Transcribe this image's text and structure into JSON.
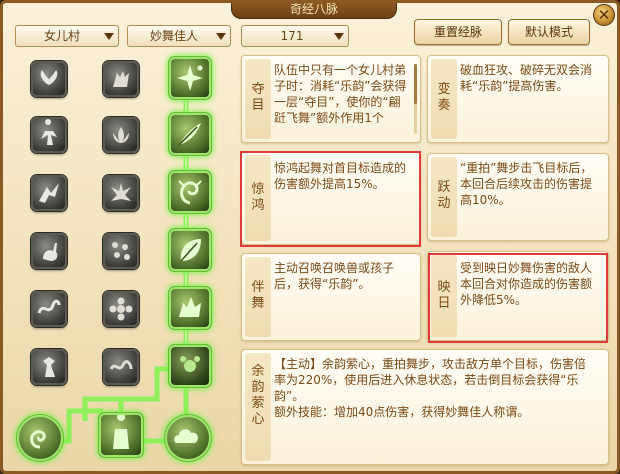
{
  "window": {
    "title": "奇经八脉",
    "close_label": "✕"
  },
  "toolbar": {
    "village": "女儿村",
    "school": "妙舞佳人",
    "points": "171",
    "reset_label": "重置经脉",
    "default_label": "默认模式"
  },
  "meridian_grid": {
    "nodes": [
      {
        "name": "node-r1c1",
        "state": "inactive",
        "icon": "wings-icon"
      },
      {
        "name": "node-r1c2",
        "state": "inactive",
        "icon": "hands-icon"
      },
      {
        "name": "node-r1c3",
        "state": "active",
        "icon": "sparkle-icon"
      },
      {
        "name": "node-r2c1",
        "state": "inactive",
        "icon": "dancer-icon"
      },
      {
        "name": "node-r2c2",
        "state": "inactive",
        "icon": "lotus-icon"
      },
      {
        "name": "node-r2c3",
        "state": "active",
        "icon": "feather-icon"
      },
      {
        "name": "node-r3c1",
        "state": "inactive",
        "icon": "leap-icon"
      },
      {
        "name": "node-r3c2",
        "state": "inactive",
        "icon": "splash-icon"
      },
      {
        "name": "node-r3c3",
        "state": "active",
        "icon": "swirl-icon"
      },
      {
        "name": "node-r4c1",
        "state": "inactive",
        "icon": "rabbit-icon"
      },
      {
        "name": "node-r4c2",
        "state": "inactive",
        "icon": "dots-icon"
      },
      {
        "name": "node-r4c3",
        "state": "active",
        "icon": "leaf-icon"
      },
      {
        "name": "node-r5c1",
        "state": "inactive",
        "icon": "ribbon-icon"
      },
      {
        "name": "node-r5c2",
        "state": "inactive",
        "icon": "flower-icon"
      },
      {
        "name": "node-r5c3",
        "state": "active",
        "icon": "beast-icon"
      },
      {
        "name": "node-r6c1",
        "state": "inactive",
        "icon": "figure-icon"
      },
      {
        "name": "node-r6c2",
        "state": "inactive",
        "icon": "serpent-icon"
      },
      {
        "name": "node-r6c3",
        "state": "active",
        "icon": "blossom-icon"
      },
      {
        "name": "node-r7c1",
        "state": "active",
        "icon": "spiral-icon"
      },
      {
        "name": "node-r7c2",
        "state": "active",
        "icon": "sage-icon"
      },
      {
        "name": "node-r7c3",
        "state": "active",
        "icon": "cloud-icon"
      }
    ]
  },
  "cards": [
    {
      "id": "duomu",
      "name": "夺目",
      "desc": "队伍中只有一个女儿村弟子时：消耗“乐韵”会获得一层“夺目”，使你的“翩跹飞舞”额外作用1个"
    },
    {
      "id": "bianzou",
      "name": "变奏",
      "desc": "破血狂攻、破碎无双会消耗“乐韵”提高伤害。"
    },
    {
      "id": "jinghong",
      "name": "惊鸿",
      "desc": "惊鸿起舞对首目标造成的伤害额外提高15%。"
    },
    {
      "id": "yuedong",
      "name": "跃动",
      "desc": "“重拍”舞步击飞目标后，本回合后续攻击的伤害提高10%。"
    },
    {
      "id": "banwu",
      "name": "伴舞",
      "desc": "主动召唤召唤兽或孩子后，获得“乐韵”。"
    },
    {
      "id": "yingri",
      "name": "映日",
      "desc": "受到映日妙舞伤害的敌人本回合对你造成的伤害额外降低5%。"
    },
    {
      "id": "yuyun",
      "name": "余韵萦心",
      "desc_line1": "【主动】余韵萦心，重拍舞步，攻击敌方单个目标，伤害倍率为220%，使用后进入休息状态，若击倒目标会获得“乐韵”。",
      "desc_line2": "额外技能：增加40点伤害，获得妙舞佳人称谓。"
    }
  ],
  "colors": {
    "accent_green": "#7cf24a",
    "highlight_red": "#e03a3a",
    "text_brown": "#7c4a16"
  }
}
